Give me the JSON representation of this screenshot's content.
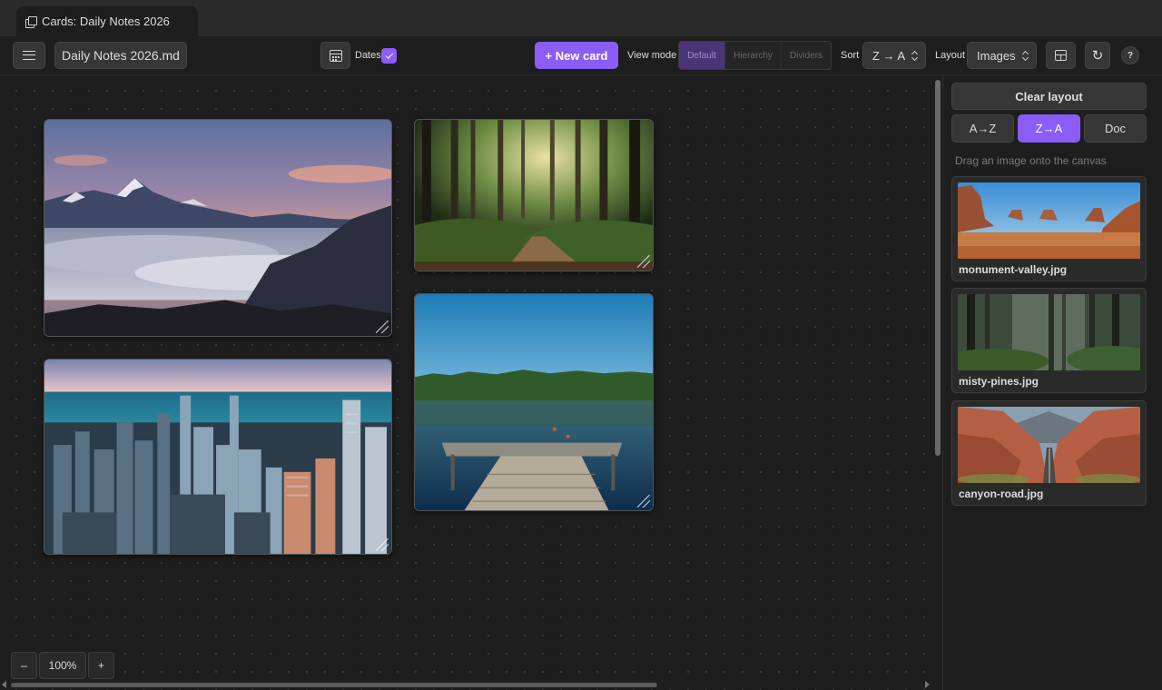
{
  "tab": {
    "title": "Cards: Daily Notes 2026",
    "icon": "copy-icon"
  },
  "toolbar": {
    "file_name": "Daily Notes 2026.md",
    "dates_label": "Dates",
    "dates_checked": true,
    "new_card_label": "+ New card",
    "view_mode_label": "View mode",
    "view_modes": [
      "Default",
      "Hierarchy",
      "Dividers"
    ],
    "view_mode_active": "Default",
    "sort_label": "Sort",
    "sort_value": "Z → A",
    "layout_label": "Layout",
    "layout_value": "Images",
    "refresh_glyph": "↻",
    "help_glyph": "?"
  },
  "canvas": {
    "cards": [
      {
        "image": "mountain-sunset-clouds"
      },
      {
        "image": "forest-path"
      },
      {
        "image": "city-skyline-lake"
      },
      {
        "image": "lake-dock"
      }
    ],
    "zoom": {
      "out_label": "–",
      "level": "100%",
      "in_label": "+"
    }
  },
  "sidebar": {
    "clear_label": "Clear layout",
    "sort_buttons": [
      "A→Z",
      "Z→A",
      "Doc"
    ],
    "sort_active": "Z→A",
    "hint": "Drag an image onto the canvas",
    "images": [
      {
        "name": "monument-valley.jpg"
      },
      {
        "name": "misty-pines.jpg"
      },
      {
        "name": "canyon-road.jpg"
      }
    ]
  },
  "colors": {
    "accent": "#8b5cf6",
    "background": "#1e1e1e",
    "panel": "#363636"
  }
}
